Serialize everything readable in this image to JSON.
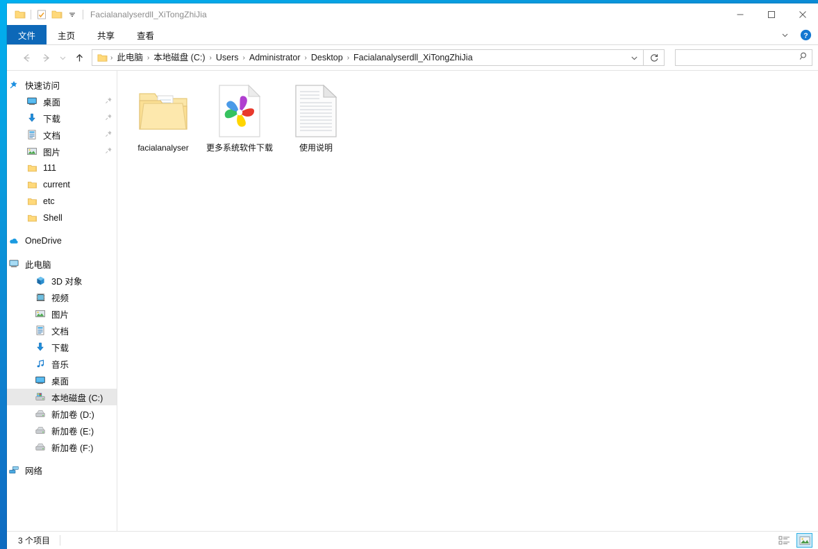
{
  "window": {
    "title": "Facialanalyserdll_XiTongZhiJia",
    "quick_access": [
      {
        "name": "folder-icon",
        "label": "文件夹"
      },
      {
        "name": "properties-icon",
        "label": "属性"
      },
      {
        "name": "new-folder-icon",
        "label": "新建文件夹"
      },
      {
        "name": "customize-dropdown-icon",
        "label": "自定义快速访问工具栏"
      }
    ],
    "controls": {
      "minimize": "最小化",
      "maximize": "最大化",
      "close": "关闭"
    }
  },
  "ribbon": {
    "tabs": [
      {
        "label": "文件",
        "active": true
      },
      {
        "label": "主页",
        "active": false
      },
      {
        "label": "共享",
        "active": false
      },
      {
        "label": "查看",
        "active": false
      }
    ],
    "expand_label": "展开功能区",
    "help_label": "帮助"
  },
  "address": {
    "back_label": "返回",
    "forward_label": "前进",
    "recent_label": "最近浏览的位置",
    "up_label": "上移到上一级",
    "breadcrumbs": [
      "此电脑",
      "本地磁盘 (C:)",
      "Users",
      "Administrator",
      "Desktop",
      "Facialanalyserdll_XiTongZhiJia"
    ],
    "separator": "›",
    "dropdown_label": "以前的位置",
    "refresh_label": "刷新"
  },
  "search": {
    "value": "",
    "placeholder": ""
  },
  "sidebar": {
    "groups": [
      {
        "header": {
          "label": "快速访问",
          "icon": "star-pin-icon"
        },
        "items": [
          {
            "label": "桌面",
            "icon": "desktop-icon",
            "pinned": true,
            "indent": 1
          },
          {
            "label": "下载",
            "icon": "downloads-icon",
            "pinned": true,
            "indent": 1
          },
          {
            "label": "文档",
            "icon": "documents-icon",
            "pinned": true,
            "indent": 1
          },
          {
            "label": "图片",
            "icon": "pictures-icon",
            "pinned": true,
            "indent": 1
          },
          {
            "label": "111",
            "icon": "folder-icon",
            "pinned": false,
            "indent": 1
          },
          {
            "label": "current",
            "icon": "folder-icon",
            "pinned": false,
            "indent": 1
          },
          {
            "label": "etc",
            "icon": "folder-icon",
            "pinned": false,
            "indent": 1
          },
          {
            "label": "Shell",
            "icon": "folder-icon",
            "pinned": false,
            "indent": 1
          }
        ]
      },
      {
        "header": {
          "label": "OneDrive",
          "icon": "onedrive-icon"
        },
        "items": []
      },
      {
        "header": {
          "label": "此电脑",
          "icon": "this-pc-icon"
        },
        "items": [
          {
            "label": "3D 对象",
            "icon": "3d-objects-icon",
            "pinned": false,
            "indent": 1
          },
          {
            "label": "视频",
            "icon": "videos-icon",
            "pinned": false,
            "indent": 1
          },
          {
            "label": "图片",
            "icon": "pictures-icon",
            "pinned": false,
            "indent": 1
          },
          {
            "label": "文档",
            "icon": "documents-icon",
            "pinned": false,
            "indent": 1
          },
          {
            "label": "下载",
            "icon": "downloads-icon",
            "pinned": false,
            "indent": 1
          },
          {
            "label": "音乐",
            "icon": "music-icon",
            "pinned": false,
            "indent": 1
          },
          {
            "label": "桌面",
            "icon": "desktop-icon",
            "pinned": false,
            "indent": 1
          },
          {
            "label": "本地磁盘 (C:)",
            "icon": "system-drive-icon",
            "pinned": false,
            "indent": 1,
            "selected": true
          },
          {
            "label": "新加卷 (D:)",
            "icon": "drive-icon",
            "pinned": false,
            "indent": 1
          },
          {
            "label": "新加卷 (E:)",
            "icon": "drive-icon",
            "pinned": false,
            "indent": 1
          },
          {
            "label": "新加卷 (F:)",
            "icon": "drive-icon",
            "pinned": false,
            "indent": 1
          }
        ]
      },
      {
        "header": {
          "label": "网络",
          "icon": "network-icon"
        },
        "items": []
      }
    ]
  },
  "files": [
    {
      "label": "facialanalyser",
      "icon": "folder-icon",
      "type": "folder"
    },
    {
      "label": "更多系统软件下载",
      "icon": "pinwheel-shortcut-icon",
      "type": "internet-shortcut"
    },
    {
      "label": "使用说明",
      "icon": "text-document-icon",
      "type": "text"
    }
  ],
  "status": {
    "item_count": "3 个项目",
    "view_details_label": "详细信息",
    "view_large_icons_label": "大图标"
  },
  "colors": {
    "accent_blue": "#0d68b8",
    "selected_gray": "#e8e8e8",
    "folder_yellow": "#ffd97a",
    "pinwheel_purple": "#b03fd0",
    "pinwheel_red": "#e8392c",
    "pinwheel_yellow": "#ffd500",
    "pinwheel_green": "#36c25f",
    "pinwheel_blue": "#4a9ae8"
  }
}
